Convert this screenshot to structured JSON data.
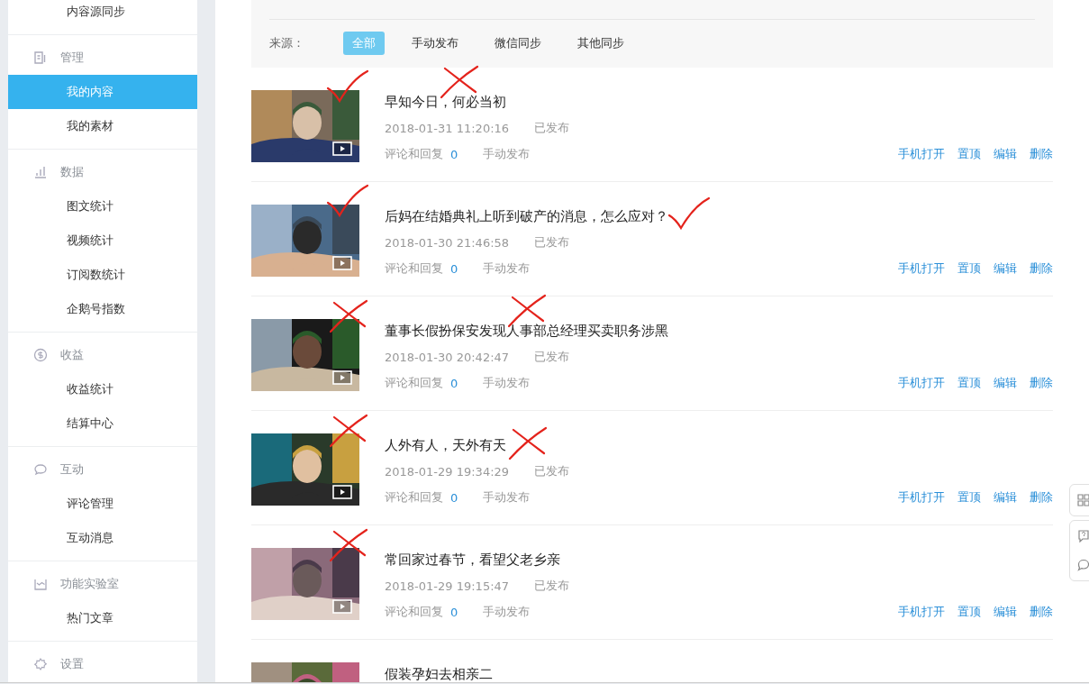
{
  "sidebar": {
    "groups": [
      {
        "items": [
          {
            "label": "内容源同步",
            "selected": false
          }
        ]
      },
      {
        "title": "管理",
        "items": [
          {
            "label": "我的内容",
            "selected": true
          },
          {
            "label": "我的素材",
            "selected": false
          }
        ]
      },
      {
        "title": "数据",
        "items": [
          {
            "label": "图文统计",
            "selected": false
          },
          {
            "label": "视频统计",
            "selected": false
          },
          {
            "label": "订阅数统计",
            "selected": false
          },
          {
            "label": "企鹅号指数",
            "selected": false
          }
        ]
      },
      {
        "title": "收益",
        "items": [
          {
            "label": "收益统计",
            "selected": false
          },
          {
            "label": "结算中心",
            "selected": false
          }
        ]
      },
      {
        "title": "互动",
        "items": [
          {
            "label": "评论管理",
            "selected": false
          },
          {
            "label": "互动消息",
            "selected": false
          }
        ]
      },
      {
        "title": "功能实验室",
        "items": [
          {
            "label": "热门文章",
            "selected": false
          }
        ]
      },
      {
        "title": "设置"
      }
    ]
  },
  "filter": {
    "label": "来源：",
    "options": [
      {
        "label": "全部",
        "selected": true
      },
      {
        "label": "手动发布",
        "selected": false
      },
      {
        "label": "微信同步",
        "selected": false
      },
      {
        "label": "其他同步",
        "selected": false
      }
    ]
  },
  "articles": [
    {
      "kind": "video",
      "title": "早知今日，何必当初",
      "date": "2018-01-31 11:20:16",
      "status": "已发布",
      "comments_label": "评论和回复",
      "comments_count": "0",
      "source": "手动发布",
      "actions": [
        "手机打开",
        "置顶",
        "编辑",
        "删除"
      ],
      "thumbnail_marks": [
        {
          "kind": "check"
        }
      ],
      "title_marks": [
        {
          "kind": "cross"
        }
      ]
    },
    {
      "kind": "video",
      "title": "后妈在结婚典礼上听到破产的消息，怎么应对？",
      "date": "2018-01-30 21:46:58",
      "status": "已发布",
      "comments_label": "评论和回复",
      "comments_count": "0",
      "source": "手动发布",
      "actions": [
        "手机打开",
        "置顶",
        "编辑",
        "删除"
      ],
      "thumbnail_marks": [
        {
          "kind": "check"
        }
      ],
      "after_title_marks": [
        {
          "kind": "check"
        }
      ]
    },
    {
      "kind": "video",
      "title": "董事长假扮保安发现人事部总经理买卖职务涉黑",
      "date": "2018-01-30 20:42:47",
      "status": "已发布",
      "comments_label": "评论和回复",
      "comments_count": "0",
      "source": "手动发布",
      "actions": [
        "手机打开",
        "置顶",
        "编辑",
        "删除"
      ],
      "thumbnail_marks": [
        {
          "kind": "cross"
        }
      ],
      "title_marks": [
        {
          "kind": "cross"
        }
      ]
    },
    {
      "kind": "video",
      "title": "人外有人，天外有天",
      "date": "2018-01-29 19:34:29",
      "status": "已发布",
      "comments_label": "评论和回复",
      "comments_count": "0",
      "source": "手动发布",
      "actions": [
        "手机打开",
        "置顶",
        "编辑",
        "删除"
      ],
      "thumbnail_marks": [
        {
          "kind": "cross"
        }
      ],
      "after_title_marks": [
        {
          "kind": "cross"
        }
      ]
    },
    {
      "kind": "video",
      "title": "常回家过春节，看望父老乡亲",
      "date": "2018-01-29 19:15:47",
      "status": "已发布",
      "comments_label": "评论和回复",
      "comments_count": "0",
      "source": "手动发布",
      "actions": [
        "手机打开",
        "置顶",
        "编辑",
        "删除"
      ],
      "thumbnail_marks": [
        {
          "kind": "cross"
        }
      ]
    },
    {
      "title": "假装孕妇去相亲二"
    }
  ]
}
